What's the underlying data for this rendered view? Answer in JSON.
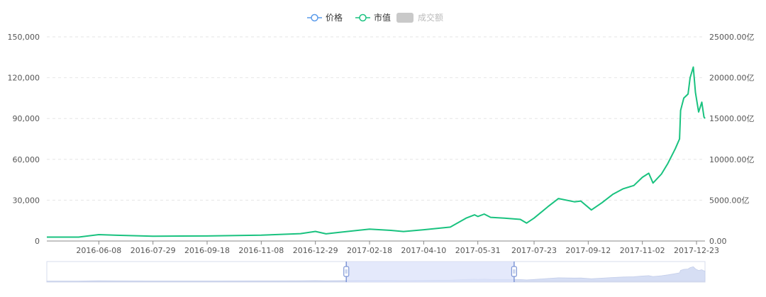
{
  "legend": {
    "items": [
      {
        "label": "价格",
        "color": "#5b9bea",
        "kind": "line"
      },
      {
        "label": "市值",
        "color": "#19c27f",
        "kind": "line"
      },
      {
        "label": "成交额",
        "color": "#c9c9c9",
        "kind": "box",
        "disabled": true
      }
    ]
  },
  "colors": {
    "market_cap_line": "#19c27f",
    "grid": "#e6e6e6",
    "axis_text": "#555555",
    "slider_fill": "#dbe2f9",
    "slider_handle": "#7f97d6",
    "slider_border": "#c7d1ef",
    "overview_area": "#d6def4"
  },
  "chart_data": {
    "type": "line",
    "title": "",
    "xlabel": "",
    "ylabel": "",
    "x_tick_labels": [
      "2016-06-08",
      "2016-07-29",
      "2016-09-18",
      "2016-11-08",
      "2016-12-29",
      "2017-02-18",
      "2017-04-10",
      "2017-05-31",
      "2017-07-23",
      "2017-09-12",
      "2017-11-02",
      "2017-12-23"
    ],
    "y_left_ticks": [
      "0",
      "30,000",
      "60,000",
      "90,000",
      "120,000",
      "150,000"
    ],
    "y_left_range": [
      0,
      150000
    ],
    "y_right_ticks": [
      "0.00",
      "5000.00亿",
      "10000.00亿",
      "15000.00亿",
      "20000.00亿",
      "25000.00亿"
    ],
    "y_right_range": [
      0,
      25000
    ],
    "grid": true,
    "legend_position": "top-center",
    "series": [
      {
        "name": "市值",
        "axis": "right",
        "x": [
          "2016-04-20",
          "2016-05-20",
          "2016-06-08",
          "2016-06-25",
          "2016-07-29",
          "2016-09-18",
          "2016-11-08",
          "2016-12-15",
          "2016-12-29",
          "2017-01-08",
          "2017-01-20",
          "2017-02-18",
          "2017-03-10",
          "2017-03-22",
          "2017-04-10",
          "2017-05-05",
          "2017-05-20",
          "2017-05-28",
          "2017-05-31",
          "2017-06-06",
          "2017-06-12",
          "2017-06-25",
          "2017-07-10",
          "2017-07-16",
          "2017-07-23",
          "2017-08-05",
          "2017-08-15",
          "2017-08-30",
          "2017-09-05",
          "2017-09-15",
          "2017-09-25",
          "2017-10-05",
          "2017-10-15",
          "2017-10-25",
          "2017-11-02",
          "2017-11-08",
          "2017-11-12",
          "2017-11-20",
          "2017-11-26",
          "2017-12-03",
          "2017-12-07",
          "2017-12-08",
          "2017-12-11",
          "2017-12-15",
          "2017-12-17",
          "2017-12-20",
          "2017-12-22",
          "2017-12-25",
          "2017-12-28",
          "2017-12-30",
          "2017-12-31"
        ],
        "values": [
          480,
          480,
          780,
          700,
          590,
          620,
          710,
          900,
          1170,
          880,
          1050,
          1460,
          1300,
          1160,
          1380,
          1700,
          2800,
          3200,
          3000,
          3300,
          2900,
          2800,
          2650,
          2200,
          2800,
          4200,
          5200,
          4800,
          4900,
          3800,
          4700,
          5700,
          6400,
          6800,
          7800,
          8300,
          7100,
          8200,
          9500,
          11300,
          12500,
          16000,
          17500,
          18000,
          20000,
          21300,
          18200,
          15800,
          17000,
          15200,
          15000
        ]
      }
    ]
  },
  "zoom_slider": {
    "start_label_hidden": true,
    "range_start_fraction": 0.455,
    "range_end_fraction": 0.71
  }
}
